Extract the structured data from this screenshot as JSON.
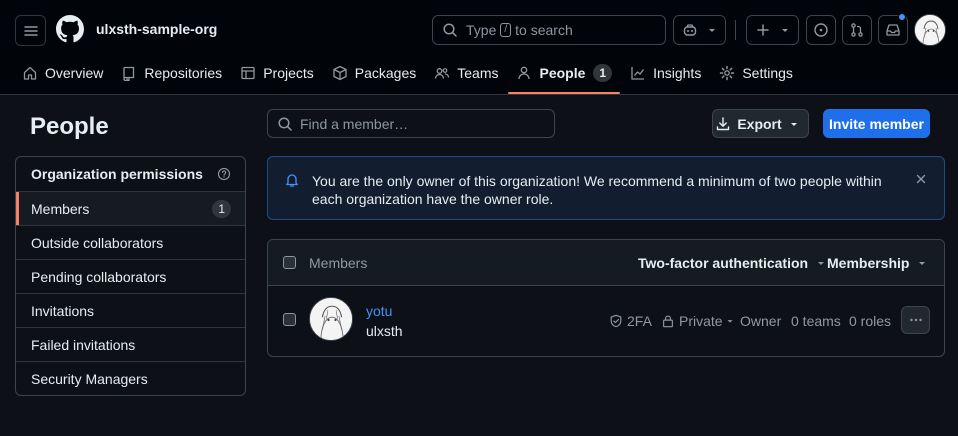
{
  "header": {
    "org_name": "ulxsth-sample-org",
    "search": {
      "prefix": "Type",
      "key": "/",
      "suffix": "to search"
    }
  },
  "nav": [
    {
      "label": "Overview",
      "icon": "home-icon"
    },
    {
      "label": "Repositories",
      "icon": "repo-icon"
    },
    {
      "label": "Projects",
      "icon": "table-icon"
    },
    {
      "label": "Packages",
      "icon": "package-icon"
    },
    {
      "label": "Teams",
      "icon": "people-icon"
    },
    {
      "label": "People",
      "icon": "person-icon",
      "count": "1",
      "active": true
    },
    {
      "label": "Insights",
      "icon": "graph-icon"
    },
    {
      "label": "Settings",
      "icon": "gear-icon"
    }
  ],
  "page": {
    "title": "People"
  },
  "sidebar": {
    "heading": "Organization permissions",
    "items": [
      {
        "label": "Members",
        "count": "1",
        "active": true
      },
      {
        "label": "Outside collaborators"
      },
      {
        "label": "Pending collaborators"
      },
      {
        "label": "Invitations"
      },
      {
        "label": "Failed invitations"
      },
      {
        "label": "Security Managers"
      }
    ]
  },
  "toolbar": {
    "find_placeholder": "Find a member…",
    "export_label": "Export",
    "invite_label": "Invite member"
  },
  "flash": {
    "message": "You are the only owner of this organization! We recommend a minimum of two people within each organization have the owner role."
  },
  "members_table": {
    "header_label": "Members",
    "filter_2fa": "Two-factor authentication",
    "filter_membership": "Membership",
    "rows": [
      {
        "login": "yotu",
        "name": "ulxsth",
        "two_factor": "2FA",
        "visibility": "Private",
        "role": "Owner",
        "teams": "0 teams",
        "roles": "0 roles"
      }
    ]
  },
  "colors": {
    "accent": "#f78166",
    "primary_button": "#1f6feb",
    "link": "#4493f8"
  }
}
